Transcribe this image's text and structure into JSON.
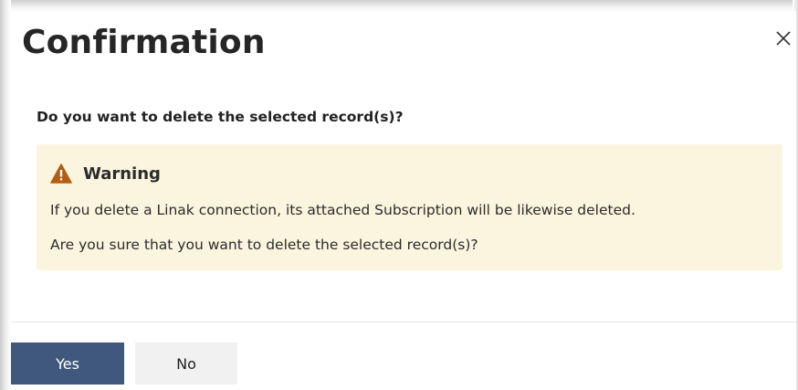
{
  "dialog": {
    "title": "Confirmation",
    "close_icon": "close-icon",
    "question": "Do you want to delete the selected record(s)?",
    "warning": {
      "icon": "warning-triangle-icon",
      "title": "Warning",
      "lines": [
        "If you delete a Linak connection, its attached Subscription will be likewise deleted.",
        "Are you sure that you want to delete the selected record(s)?"
      ]
    },
    "buttons": {
      "yes_label": "Yes",
      "no_label": "No"
    }
  },
  "colors": {
    "primary_button": "#3f587c",
    "secondary_button": "#f1f1f1",
    "warning_background": "#fbf4de",
    "warning_icon": "#b15e12"
  }
}
